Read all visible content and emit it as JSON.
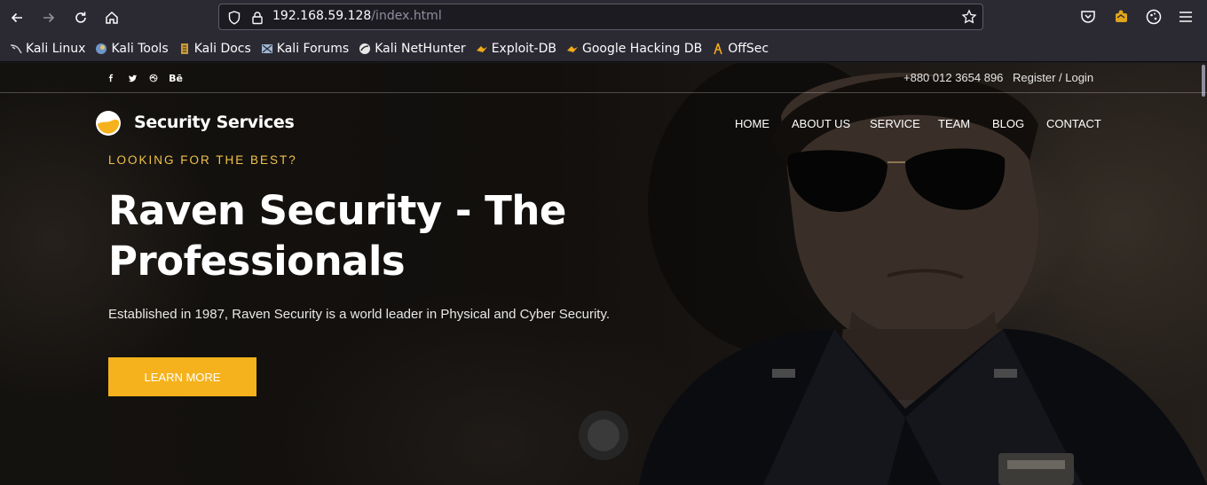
{
  "browser": {
    "url_host": "192.168.59.128",
    "url_path": "/index.html",
    "bookmarks": [
      {
        "label": "Kali Linux",
        "icon": "kali-dragon-icon"
      },
      {
        "label": "Kali Tools",
        "icon": "kali-tools-icon"
      },
      {
        "label": "Kali Docs",
        "icon": "kali-docs-icon"
      },
      {
        "label": "Kali Forums",
        "icon": "kali-forums-icon"
      },
      {
        "label": "Kali NetHunter",
        "icon": "nethunter-icon"
      },
      {
        "label": "Exploit-DB",
        "icon": "exploit-db-icon"
      },
      {
        "label": "Google Hacking DB",
        "icon": "ghdb-icon"
      },
      {
        "label": "OffSec",
        "icon": "offsec-icon"
      }
    ]
  },
  "site": {
    "topbar": {
      "social_behance": "Bē",
      "phone": "+880 012 3654 896",
      "auth": "Register / Login"
    },
    "brand": "Security Services",
    "nav": [
      "HOME",
      "ABOUT US",
      "SERVICE",
      "TEAM",
      "BLOG",
      "CONTACT"
    ],
    "hero": {
      "eyebrow": "LOOKING FOR THE BEST?",
      "headline": "Raven Security - The Professionals",
      "subtitle": "Established in 1987, Raven Security is a world leader in Physical and Cyber Security.",
      "cta": "LEARN MORE"
    }
  },
  "colors": {
    "accent": "#f5b21c",
    "browser_bg": "#2b2a33",
    "url_bg": "#1c1b22"
  }
}
